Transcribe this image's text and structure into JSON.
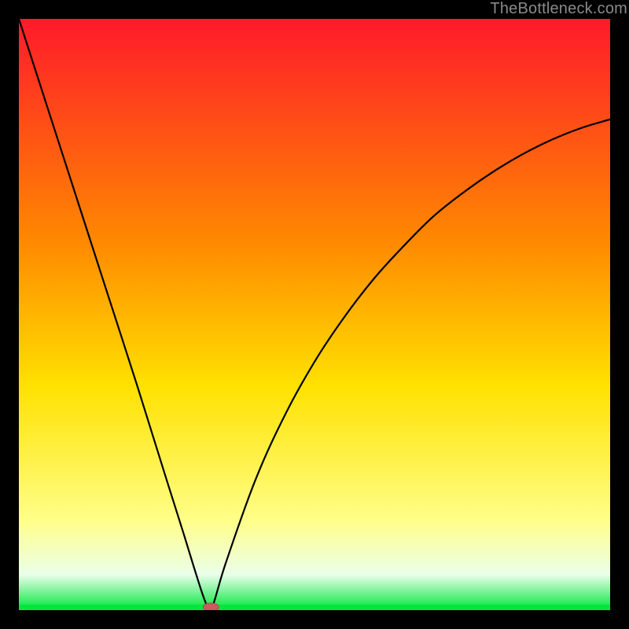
{
  "watermark": "TheBottleneck.com",
  "colors": {
    "bg": "#000000",
    "gradient_top": "#ff1a2a",
    "gradient_mid_upper": "#ff8a00",
    "gradient_mid": "#ffe100",
    "gradient_low": "#ffff8a",
    "gradient_floor": "#eaffea",
    "gradient_bottom": "#00e63b",
    "curve": "#000000",
    "floor": "#00e63b",
    "marker_fill": "#cc5a5f",
    "marker_stroke": "#b34a4f"
  },
  "chart_data": {
    "type": "line",
    "title": "",
    "xlabel": "",
    "ylabel": "",
    "xlim": [
      0,
      100
    ],
    "ylim": [
      0,
      100
    ],
    "series": [
      {
        "name": "bottleneck-curve",
        "x": [
          0,
          5,
          10,
          15,
          20,
          25,
          28,
          30,
          31.5,
          32.5,
          35,
          40,
          45,
          50,
          55,
          60,
          65,
          70,
          75,
          80,
          85,
          90,
          95,
          100
        ],
        "values": [
          100,
          84.5,
          69,
          53.5,
          38,
          22,
          12.5,
          6,
          1.5,
          0,
          8,
          22,
          33,
          42,
          49.5,
          56,
          61.5,
          66.5,
          70.5,
          74,
          77,
          79.5,
          81.5,
          83
        ]
      }
    ],
    "annotations": [
      {
        "name": "min-marker",
        "x": 32.5,
        "y": 0
      }
    ],
    "grid": false,
    "legend": false
  }
}
